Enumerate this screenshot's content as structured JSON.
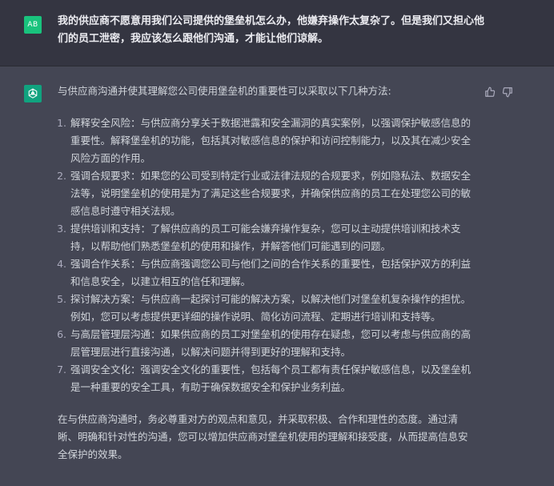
{
  "user_message": {
    "avatar_initials": "AB",
    "text": "我的供应商不愿意用我们公司提供的堡垒机怎么办，他嫌弃操作太复杂了。但是我们又担心他们的员工泄密，我应该怎么跟他们沟通，才能让他们谅解。"
  },
  "assistant_message": {
    "avatar_icon": "openai-logo-icon",
    "intro": "与供应商沟通并使其理解您公司使用堡垒机的重要性可以采取以下几种方法:",
    "items": [
      {
        "number": "1.",
        "text": "解释安全风险：与供应商分享关于数据泄露和安全漏洞的真实案例，以强调保护敏感信息的重要性。解释堡垒机的功能，包括其对敏感信息的保护和访问控制能力，以及其在减少安全风险方面的作用。"
      },
      {
        "number": "2.",
        "text": "强调合规要求：如果您的公司受到特定行业或法律法规的合规要求，例如隐私法、数据安全法等，说明堡垒机的使用是为了满足这些合规要求，并确保供应商的员工在处理您公司的敏感信息时遵守相关法规。"
      },
      {
        "number": "3.",
        "text": "提供培训和支持：了解供应商的员工可能会嫌弃操作复杂，您可以主动提供培训和技术支持，以帮助他们熟悉堡垒机的使用和操作，并解答他们可能遇到的问题。"
      },
      {
        "number": "4.",
        "text": "强调合作关系：与供应商强调您公司与他们之间的合作关系的重要性，包括保护双方的利益和信息安全，以建立相互的信任和理解。"
      },
      {
        "number": "5.",
        "text": "探讨解决方案：与供应商一起探讨可能的解决方案，以解决他们对堡垒机复杂操作的担忧。例如，您可以考虑提供更详细的操作说明、简化访问流程、定期进行培训和支持等。"
      },
      {
        "number": "6.",
        "text": "与高层管理层沟通：如果供应商的员工对堡垒机的使用存在疑虑，您可以考虑与供应商的高层管理层进行直接沟通，以解决问题并得到更好的理解和支持。"
      },
      {
        "number": "7.",
        "text": "强调安全文化：强调安全文化的重要性，包括每个员工都有责任保护敏感信息，以及堡垒机是一种重要的安全工具，有助于确保数据安全和保护业务利益。"
      }
    ],
    "conclusion": "在与供应商沟通时，务必尊重对方的观点和意见，并采取积极、合作和理性的态度。通过清晰、明确和针对性的沟通，您可以增加供应商对堡垒机使用的理解和接受度，从而提高信息安全保护的效果。"
  },
  "feedback": {
    "thumbs_up_icon": "thumbs-up-icon",
    "thumbs_down_icon": "thumbs-down-icon"
  }
}
